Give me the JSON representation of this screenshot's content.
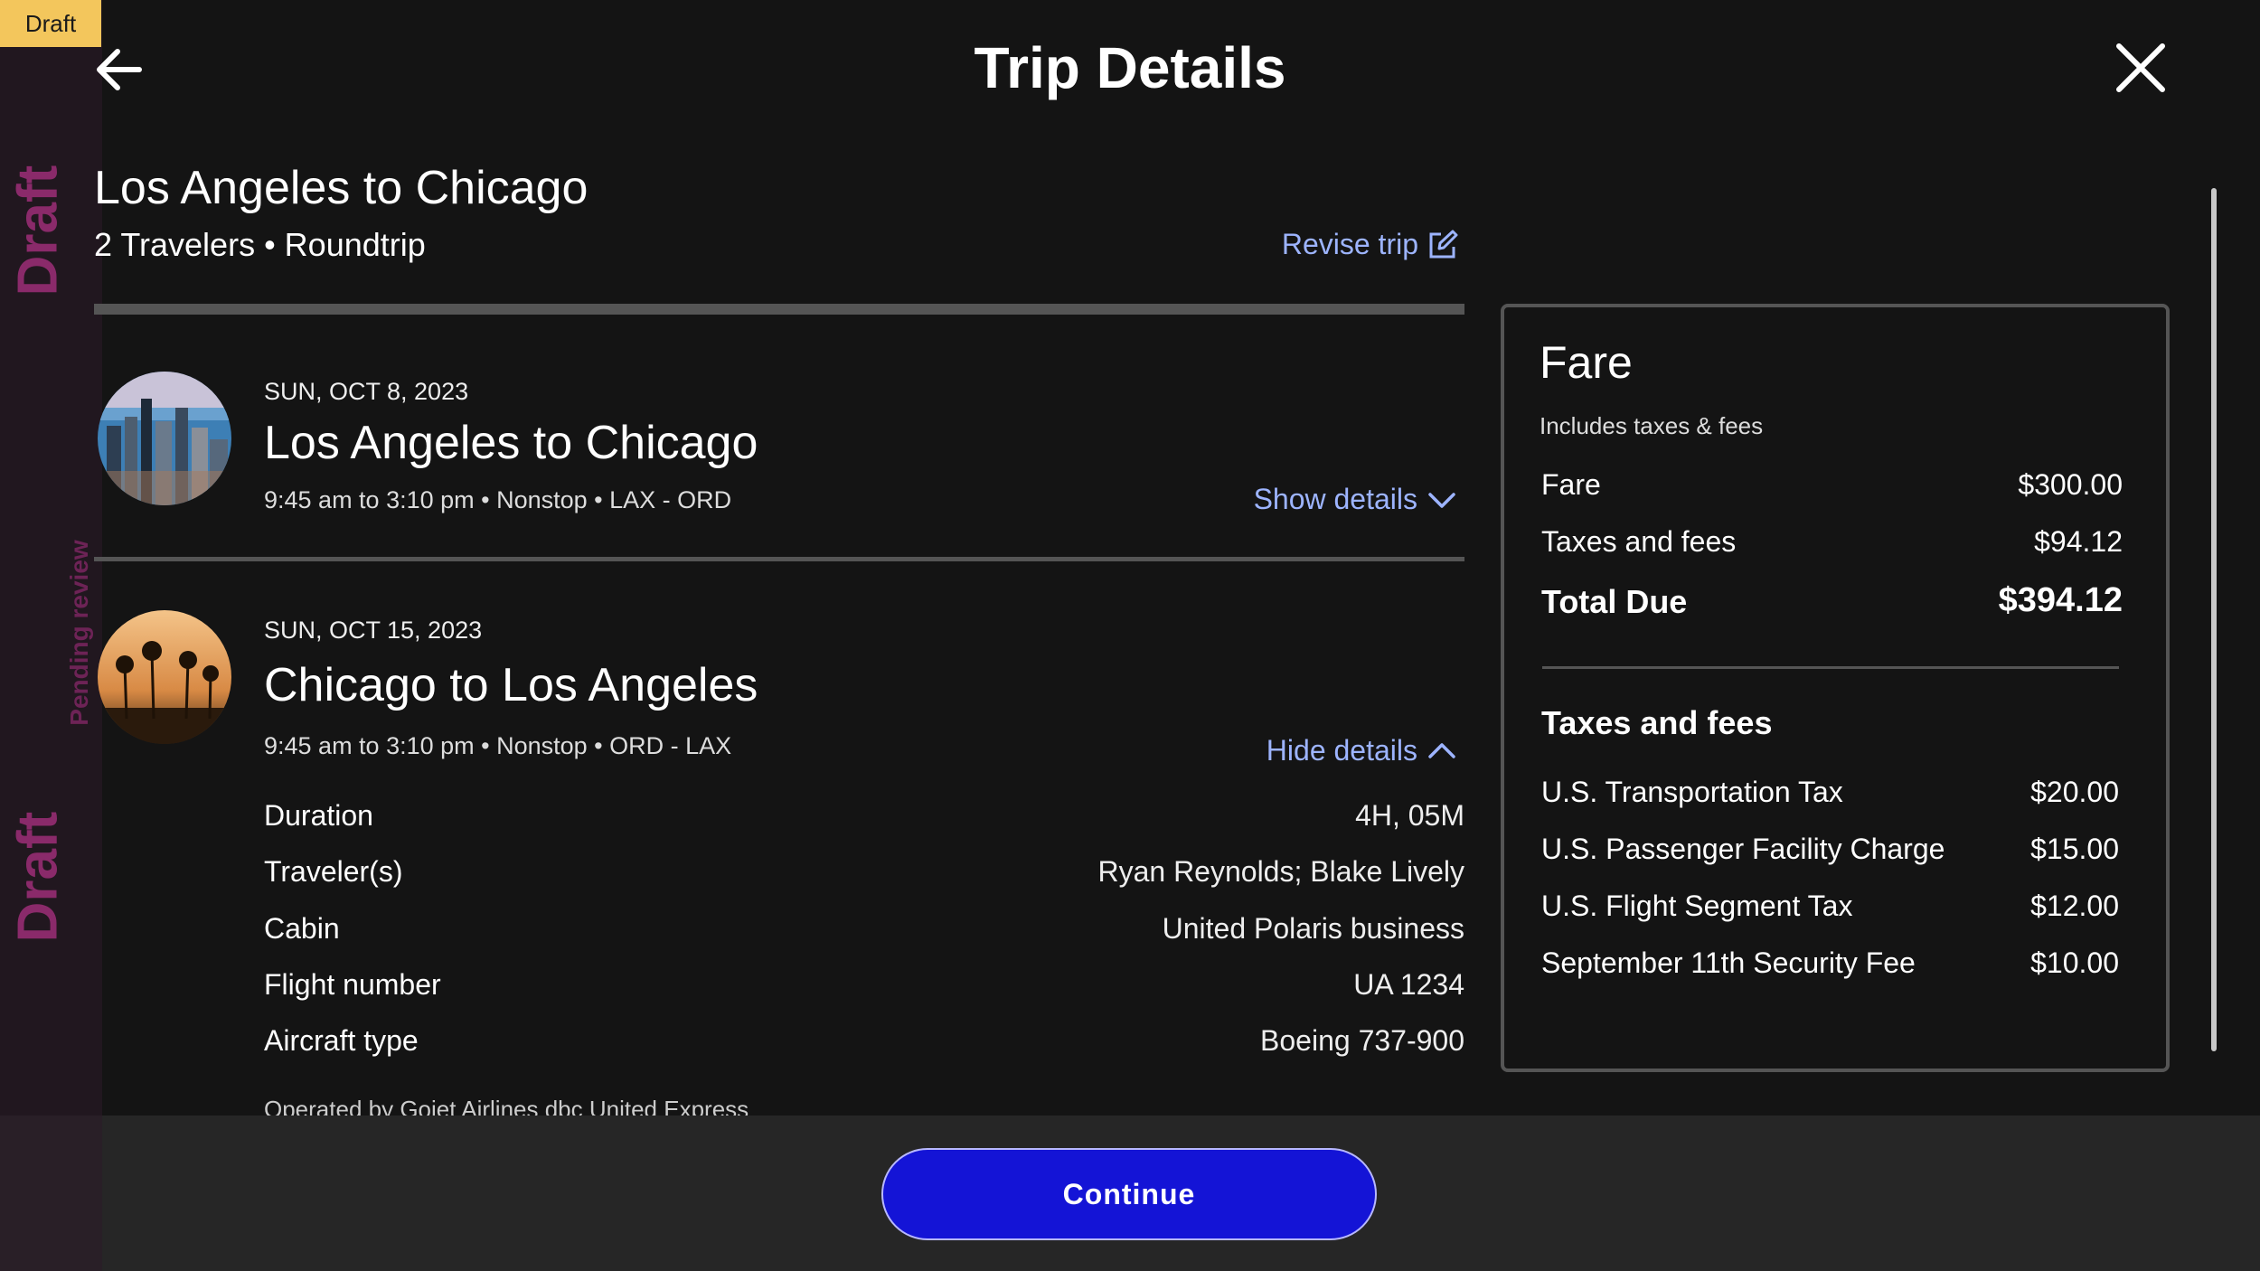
{
  "watermark": {
    "badge": "Draft",
    "vertical_draft": "Draft",
    "vertical_pending": "Pending review"
  },
  "header": {
    "title": "Trip Details",
    "back_icon": "arrow-left-icon",
    "close_icon": "close-icon"
  },
  "trip": {
    "title": "Los Angeles to Chicago",
    "subtitle": "2 Travelers • Roundtrip",
    "revise_label": "Revise trip",
    "revise_icon": "edit-icon"
  },
  "legs": [
    {
      "date": "SUN, OCT 8, 2023",
      "title": "Los Angeles to Chicago",
      "meta": "9:45 am to 3:10 pm • Nonstop • LAX - ORD",
      "toggle_label": "Show details",
      "image": "chicago-skyline"
    },
    {
      "date": "SUN, OCT 15, 2023",
      "title": "Chicago to Los Angeles",
      "meta": "9:45 am to 3:10 pm • Nonstop • ORD - LAX",
      "toggle_label": "Hide details",
      "image": "los-angeles-palms",
      "details": [
        {
          "label": "Duration",
          "value": "4H, 05M"
        },
        {
          "label": "Traveler(s)",
          "value": "Ryan Reynolds; Blake Lively"
        },
        {
          "label": "Cabin",
          "value": "United Polaris business"
        },
        {
          "label": "Flight number",
          "value": "UA 1234"
        },
        {
          "label": "Aircraft type",
          "value": "Boeing 737-900"
        }
      ],
      "operated_by": "Operated by Gojet Airlines dbc United Express"
    }
  ],
  "fare": {
    "title": "Fare",
    "note": "Includes taxes & fees",
    "lines": [
      {
        "label": "Fare",
        "value": "$300.00"
      },
      {
        "label": "Taxes and fees",
        "value": "$94.12"
      }
    ],
    "total": {
      "label": "Total Due",
      "value": "$394.12"
    },
    "taxes_title": "Taxes and fees",
    "taxes": [
      {
        "label": "U.S. Transportation Tax",
        "value": "$20.00"
      },
      {
        "label": "U.S. Passenger Facility Charge",
        "value": "$15.00"
      },
      {
        "label": "U.S. Flight Segment Tax",
        "value": "$12.00"
      },
      {
        "label": "September 11th Security Fee",
        "value": "$10.00"
      }
    ]
  },
  "footer": {
    "continue_label": "Continue"
  },
  "colors": {
    "background": "#141414",
    "link": "#9db4ff",
    "primary_button": "#1414d6",
    "draft_badge": "#f3c65c"
  }
}
